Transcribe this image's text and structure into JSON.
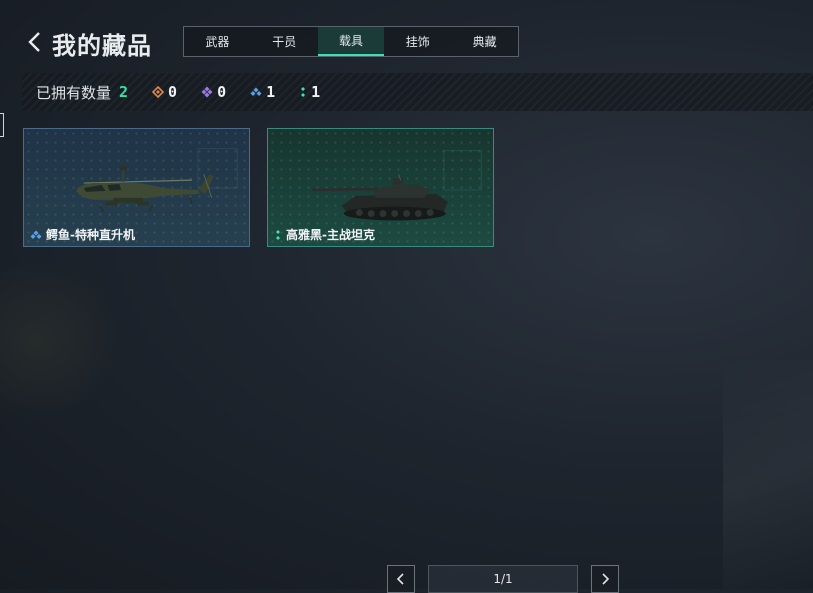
{
  "header": {
    "title": "我的藏品"
  },
  "tabs": [
    {
      "label": "武器",
      "active": false
    },
    {
      "label": "干员",
      "active": false
    },
    {
      "label": "载具",
      "active": true
    },
    {
      "label": "挂饰",
      "active": false
    },
    {
      "label": "典藏",
      "active": false
    }
  ],
  "stats": {
    "owned_label": "已拥有数量",
    "owned_total": "2",
    "rarities": [
      {
        "icon": "orange-diamond-icon",
        "color": "#e08a4a",
        "count": "0"
      },
      {
        "icon": "purple-diamond-icon",
        "color": "#9a7ae0",
        "count": "0"
      },
      {
        "icon": "blue-triple-diamond-icon",
        "color": "#5aa0e6",
        "count": "1"
      },
      {
        "icon": "green-double-dot-icon",
        "color": "#3fe0b2",
        "count": "1"
      }
    ]
  },
  "items": [
    {
      "name": "鳄鱼-特种直升机",
      "type": "helicopter",
      "rarity_icon": "blue-triple-diamond-icon",
      "rarity_color": "#5aa0e6"
    },
    {
      "name": "高雅黑-主战坦克",
      "type": "tank",
      "rarity_icon": "green-double-dot-icon",
      "rarity_color": "#3fe0b2"
    }
  ],
  "pagination": {
    "text": "1/1"
  }
}
